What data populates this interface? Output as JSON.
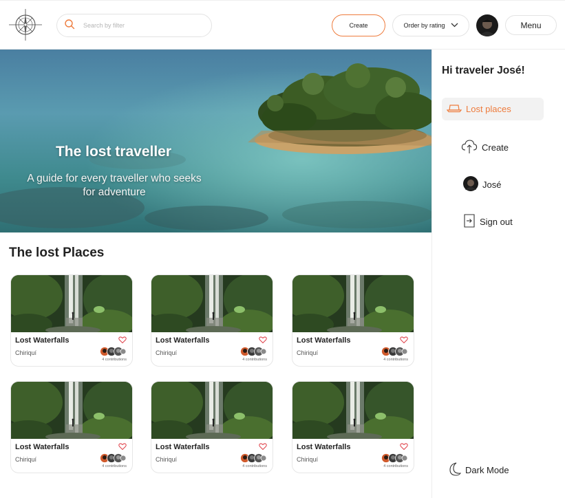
{
  "header": {
    "search_placeholder": "Search by filter",
    "create_label": "Create",
    "order_label": "Order by rating",
    "menu_label": "Menu",
    "icons": [
      "compass-logo",
      "search-icon",
      "chevron-down-icon",
      "user-avatar"
    ]
  },
  "hero": {
    "title": "The lost traveller",
    "subtitle": "A guide for every traveller who seeks for adventure"
  },
  "section": {
    "title": "The lost Places"
  },
  "cards": [
    {
      "name": "Lost Waterfalls",
      "location": "Chiriquí",
      "contributions": "4 contributions"
    },
    {
      "name": "Lost Waterfalls",
      "location": "Chiriquí",
      "contributions": "4 contributions"
    },
    {
      "name": "Lost Waterfalls",
      "location": "Chiriquí",
      "contributions": "4 contributions"
    },
    {
      "name": "Lost Waterfalls",
      "location": "Chiriquí",
      "contributions": "4 contributions"
    },
    {
      "name": "Lost Waterfalls",
      "location": "Chiriquí",
      "contributions": "4 contributions"
    },
    {
      "name": "Lost Waterfalls",
      "location": "Chiriquí",
      "contributions": "4 contributions"
    }
  ],
  "sidebar": {
    "greeting": "Hi traveler José!",
    "items": [
      {
        "label": "Lost places",
        "icon": "hat-icon",
        "active": true
      },
      {
        "label": "Create",
        "icon": "cloud-upload-icon"
      },
      {
        "label": "José",
        "icon": "user-avatar"
      },
      {
        "label": "Sign out",
        "icon": "sign-out-icon"
      }
    ],
    "dark_mode_label": "Dark Mode"
  },
  "colors": {
    "accent": "#ee7b3c",
    "heart": "#e0424a",
    "text": "#222222"
  }
}
